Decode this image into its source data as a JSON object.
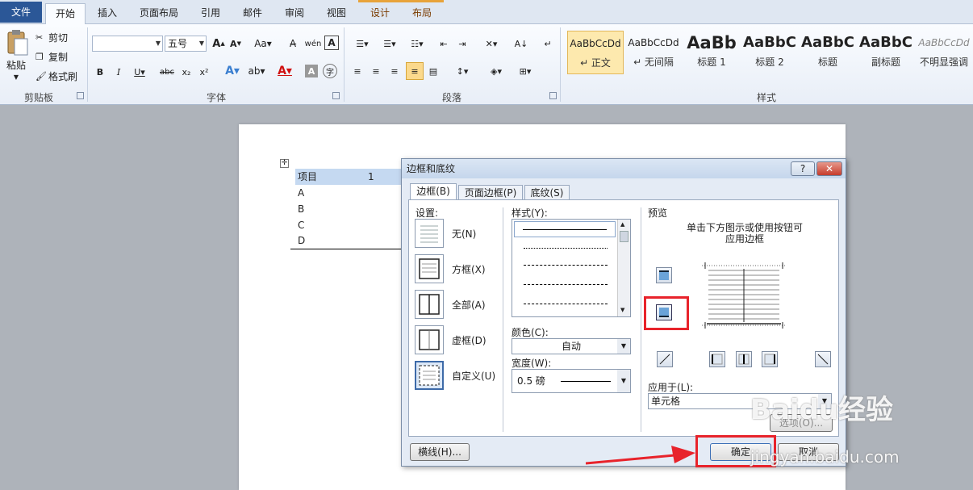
{
  "ribbon": {
    "tabs": [
      "文件",
      "开始",
      "插入",
      "页面布局",
      "引用",
      "邮件",
      "审阅",
      "视图",
      "设计",
      "布局"
    ],
    "clipboard": {
      "paste": "粘贴",
      "cut": "剪切",
      "copy": "复制",
      "format_painter": "格式刷",
      "label": "剪贴板"
    },
    "font": {
      "size": "五号",
      "label": "字体"
    },
    "paragraph": {
      "label": "段落"
    },
    "styles": {
      "label": "样式",
      "items": [
        {
          "sample": "AaBbCcDd",
          "name": "↵ 正文"
        },
        {
          "sample": "AaBbCcDd",
          "name": "↵ 无间隔"
        },
        {
          "sample": "AaBb",
          "name": "标题 1"
        },
        {
          "sample": "AaBbC",
          "name": "标题 2"
        },
        {
          "sample": "AaBbC",
          "name": "标题"
        },
        {
          "sample": "AaBbC",
          "name": "副标题"
        },
        {
          "sample": "AaBbCcDd",
          "name": "不明显强调"
        }
      ]
    }
  },
  "document": {
    "cells": [
      "项目",
      "A",
      "B",
      "C",
      "D"
    ],
    "cell_value": "1"
  },
  "dialog": {
    "title": "边框和底纹",
    "help": "?",
    "close": "✕",
    "tabs": [
      "边框(B)",
      "页面边框(P)",
      "底纹(S)"
    ],
    "setting_label": "设置:",
    "settings": [
      "无(N)",
      "方框(X)",
      "全部(A)",
      "虚框(D)",
      "自定义(U)"
    ],
    "style_label": "样式(Y):",
    "color_label": "颜色(C):",
    "color_value": "自动",
    "width_label": "宽度(W):",
    "width_value": "0.5 磅",
    "preview_label": "预览",
    "preview_hint_1": "单击下方图示或使用按钮可",
    "preview_hint_2": "应用边框",
    "apply_label": "应用于(L):",
    "apply_value": "单元格",
    "options": "选项(O)...",
    "hline": "横线(H)...",
    "ok": "确定",
    "cancel": "取消"
  },
  "watermark": {
    "brand": "Baidu经验",
    "url": "jingyan.baidu.com"
  },
  "colors": {
    "highlight": "#e8232b",
    "ribbon_file": "#2b5797"
  }
}
